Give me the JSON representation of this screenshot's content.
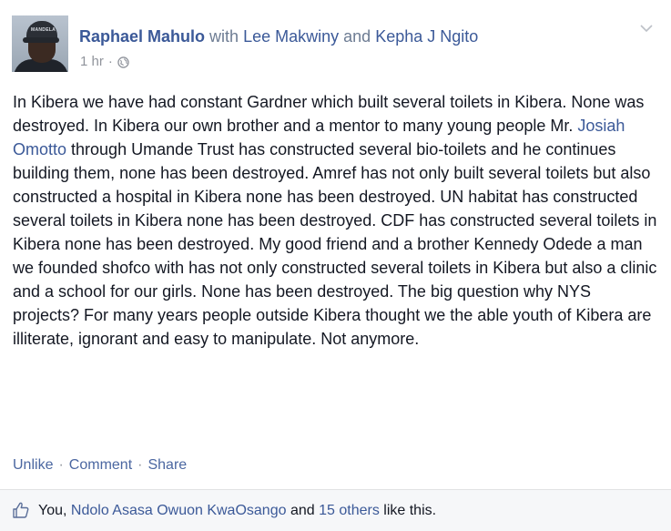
{
  "post": {
    "author": "Raphael Mahulo",
    "with_word": "with",
    "tagged_1": "Lee Makwiny",
    "and_word": "and",
    "tagged_2": "Kepha J Ngito",
    "time": "1 hr",
    "time_separator": "·",
    "avatar_cap_text": "MANDELA",
    "body_part_1": "In Kibera we have had constant Gardner which built several toilets in Kibera. None was destroyed. In Kibera our own brother and a mentor to many young people Mr. ",
    "body_mention": "Josiah Omotto",
    "body_part_2": " through Umande Trust has constructed several bio-toilets and he continues building them, none has been destroyed. Amref has not only built several toilets but also constructed a hospital in Kibera none has been destroyed. UN habitat has constructed several toilets in Kibera none has been destroyed. CDF has constructed several toilets in Kibera none has been destroyed. My good friend and a brother Kennedy Odede a man we founded shofco with has not only constructed several toilets in Kibera but also a clinic and a school for our girls. None has been destroyed. The big question why NYS projects? For many years people outside Kibera thought we the able youth of Kibera are illiterate, ignorant and easy to manipulate. Not anymore."
  },
  "actions": {
    "unlike": "Unlike",
    "comment": "Comment",
    "share": "Share",
    "separator": "·"
  },
  "likes": {
    "you": "You,",
    "person": "Ndolo Asasa Owuon KwaOsango",
    "and_word": "and",
    "others": "15 others",
    "suffix": "like this."
  },
  "colors": {
    "link": "#3b5998",
    "meta": "#90949c",
    "text": "#141823",
    "likes_bar_bg": "#f6f7f9"
  },
  "icons": [
    "globe-icon",
    "chevron-down-icon",
    "like-icon"
  ]
}
